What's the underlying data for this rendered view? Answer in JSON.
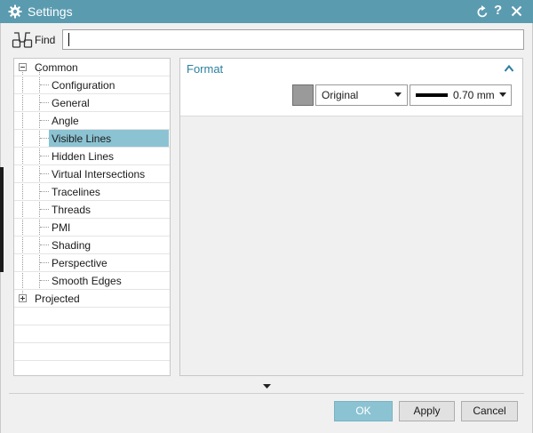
{
  "window": {
    "title": "Settings",
    "help_label": "?"
  },
  "find": {
    "label": "Find",
    "value": ""
  },
  "tree": {
    "items": [
      {
        "label": "Common",
        "level": 0,
        "expander": "-"
      },
      {
        "label": "Configuration",
        "level": 1
      },
      {
        "label": "General",
        "level": 1
      },
      {
        "label": "Angle",
        "level": 1
      },
      {
        "label": "Visible Lines",
        "level": 1,
        "selected": true
      },
      {
        "label": "Hidden Lines",
        "level": 1
      },
      {
        "label": "Virtual Intersections",
        "level": 1
      },
      {
        "label": "Tracelines",
        "level": 1
      },
      {
        "label": "Threads",
        "level": 1
      },
      {
        "label": "PMI",
        "level": 1
      },
      {
        "label": "Shading",
        "level": 1
      },
      {
        "label": "Perspective",
        "level": 1
      },
      {
        "label": "Smooth Edges",
        "level": 1
      },
      {
        "label": "Projected",
        "level": 0,
        "expander": "+"
      }
    ]
  },
  "format": {
    "title": "Format",
    "color_swatch": "#9a9a9a",
    "font_value": "Original",
    "width_value": "0.70 mm"
  },
  "buttons": {
    "ok": "OK",
    "apply": "Apply",
    "cancel": "Cancel"
  },
  "colors": {
    "titlebar": "#5a9bb0",
    "selection": "#8cc3d3",
    "section_title": "#2c7fa0"
  }
}
